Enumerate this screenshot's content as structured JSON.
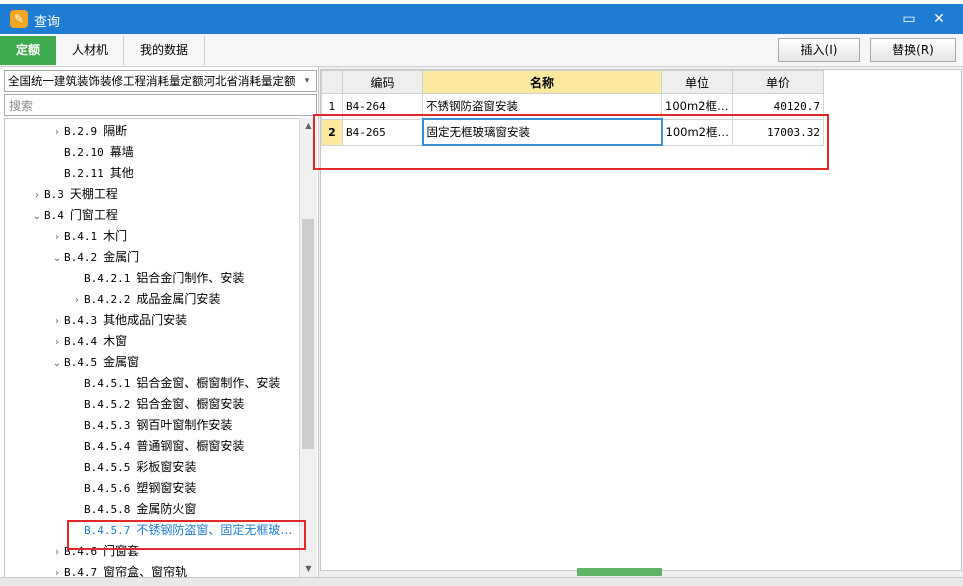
{
  "window": {
    "title": "查询",
    "minimize_glyph": "▭",
    "close_glyph": "✕"
  },
  "tabs": [
    {
      "label": "定额",
      "active": true
    },
    {
      "label": "人材机",
      "active": false
    },
    {
      "label": "我的数据",
      "active": false
    }
  ],
  "toolbar": {
    "insert_label": "插入(I)",
    "replace_label": "替换(R)"
  },
  "left": {
    "dropdown_value": "全国统一建筑装饰装修工程消耗量定额河北省消耗量定额",
    "search_placeholder": "搜索"
  },
  "tree": [
    {
      "toggle": "›",
      "code": "B.2.9",
      "label": "隔断",
      "level": 2
    },
    {
      "toggle": "",
      "code": "B.2.10",
      "label": "幕墙",
      "level": 2
    },
    {
      "toggle": "",
      "code": "B.2.11",
      "label": "其他",
      "level": 2
    },
    {
      "toggle": "›",
      "code": "B.3",
      "label": "天棚工程",
      "level": 1
    },
    {
      "toggle": "⌄",
      "code": "B.4",
      "label": "门窗工程",
      "level": 1
    },
    {
      "toggle": "›",
      "code": "B.4.1",
      "label": "木门",
      "level": 2
    },
    {
      "toggle": "⌄",
      "code": "B.4.2",
      "label": "金属门",
      "level": 2
    },
    {
      "toggle": "",
      "code": "B.4.2.1",
      "label": "铝合金门制作、安装",
      "level": 3
    },
    {
      "toggle": "›",
      "code": "B.4.2.2",
      "label": "成品金属门安装",
      "level": 3
    },
    {
      "toggle": "›",
      "code": "B.4.3",
      "label": "其他成品门安装",
      "level": 2
    },
    {
      "toggle": "›",
      "code": "B.4.4",
      "label": "木窗",
      "level": 2
    },
    {
      "toggle": "⌄",
      "code": "B.4.5",
      "label": "金属窗",
      "level": 2
    },
    {
      "toggle": "",
      "code": "B.4.5.1",
      "label": "铝合金窗、橱窗制作、安装",
      "level": 3
    },
    {
      "toggle": "",
      "code": "B.4.5.2",
      "label": "铝合金窗、橱窗安装",
      "level": 3
    },
    {
      "toggle": "",
      "code": "B.4.5.3",
      "label": "钢百叶窗制作安装",
      "level": 3
    },
    {
      "toggle": "",
      "code": "B.4.5.4",
      "label": "普通钢窗、橱窗安装",
      "level": 3
    },
    {
      "toggle": "",
      "code": "B.4.5.5",
      "label": "彩板窗安装",
      "level": 3
    },
    {
      "toggle": "",
      "code": "B.4.5.6",
      "label": "塑钢窗安装",
      "level": 3
    },
    {
      "toggle": "",
      "code": "B.4.5.8",
      "label": "金属防火窗",
      "level": 3
    },
    {
      "toggle": "",
      "code": "B.4.5.7",
      "label": "不锈钢防盗窗、固定无框玻…",
      "level": 3,
      "selected": true
    },
    {
      "toggle": "›",
      "code": "B.4.6",
      "label": "门窗套",
      "level": 2
    },
    {
      "toggle": "›",
      "code": "B.4.7",
      "label": "窗帘盒、窗帘轨",
      "level": 2
    }
  ],
  "grid": {
    "headers": [
      "",
      "编码",
      "名称",
      "单位",
      "单价"
    ],
    "rows": [
      {
        "num": "1",
        "code": "B4-264",
        "name": "不锈钢防盗窗安装",
        "unit": "100m2框…",
        "price": "40120.7"
      },
      {
        "num": "2",
        "code": "B4-265",
        "name": "固定无框玻璃窗安装",
        "unit": "100m2框…",
        "price": "17003.32"
      }
    ]
  }
}
